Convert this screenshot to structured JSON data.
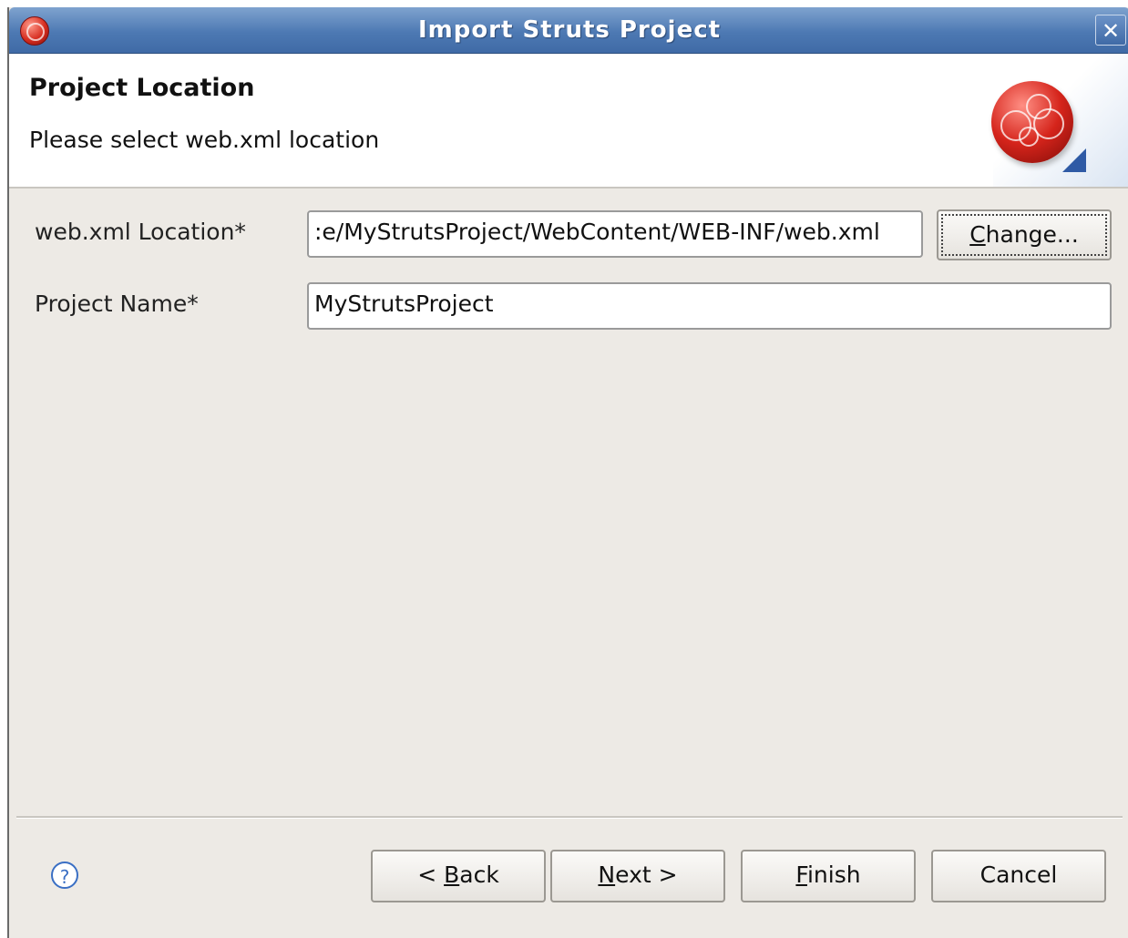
{
  "window": {
    "title": "Import Struts Project",
    "close_glyph": "✕"
  },
  "header": {
    "title": "Project Location",
    "description": "Please select web.xml location"
  },
  "form": {
    "webxml_label": "web.xml Location*",
    "webxml_value": ":e/MyStrutsProject/WebContent/WEB-INF/web.xml",
    "change_label_key": "C",
    "change_label_rest": "hange...",
    "project_label": "Project Name*",
    "project_value": "MyStrutsProject"
  },
  "footer": {
    "help_glyph": "?",
    "back_prefix": "< ",
    "back_key": "B",
    "back_rest": "ack",
    "next_key": "N",
    "next_rest": "ext >",
    "finish_key": "F",
    "finish_rest": "inish",
    "cancel_label": "Cancel"
  },
  "colors": {
    "titlebar": "#4d79b3",
    "dialog_bg": "#edeae5",
    "brand_red": "#d5241b"
  },
  "icons": [
    "app-logo-icon",
    "close-icon",
    "project-banner-icon",
    "help-icon"
  ]
}
